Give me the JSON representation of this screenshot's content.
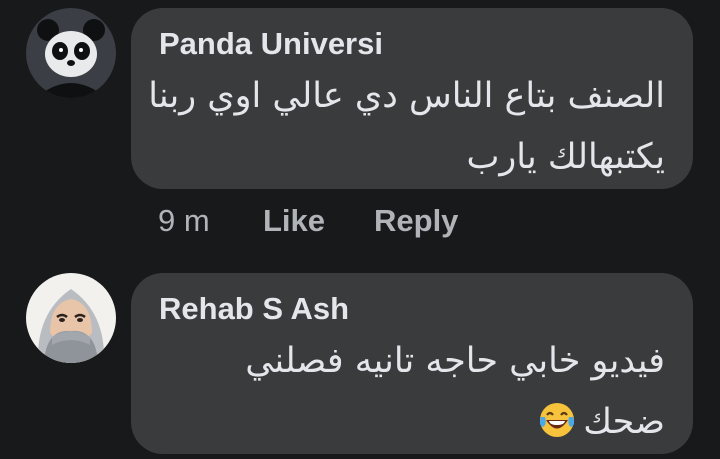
{
  "comments": [
    {
      "author": "Panda Universi",
      "text_lines": [
        "الصنف بتاع الناس دي عالي اوي ربنا",
        "يكتبهالك يارب"
      ],
      "avatar_icon": "panda-avatar-icon",
      "time": "9 m",
      "like_label": "Like",
      "reply_label": "Reply"
    },
    {
      "author": "Rehab S Ash",
      "text_lines": [
        "فيديو خابي حاجه تانيه فصلني",
        "ضحك"
      ],
      "avatar_icon": "hijab-woman-avatar-icon",
      "emoji": "laughing-tears-emoji-icon"
    }
  ],
  "colors": {
    "background": "#18191a",
    "bubble": "#3a3b3c",
    "text": "#e4e6eb",
    "secondary_text": "#b0b3b8"
  }
}
